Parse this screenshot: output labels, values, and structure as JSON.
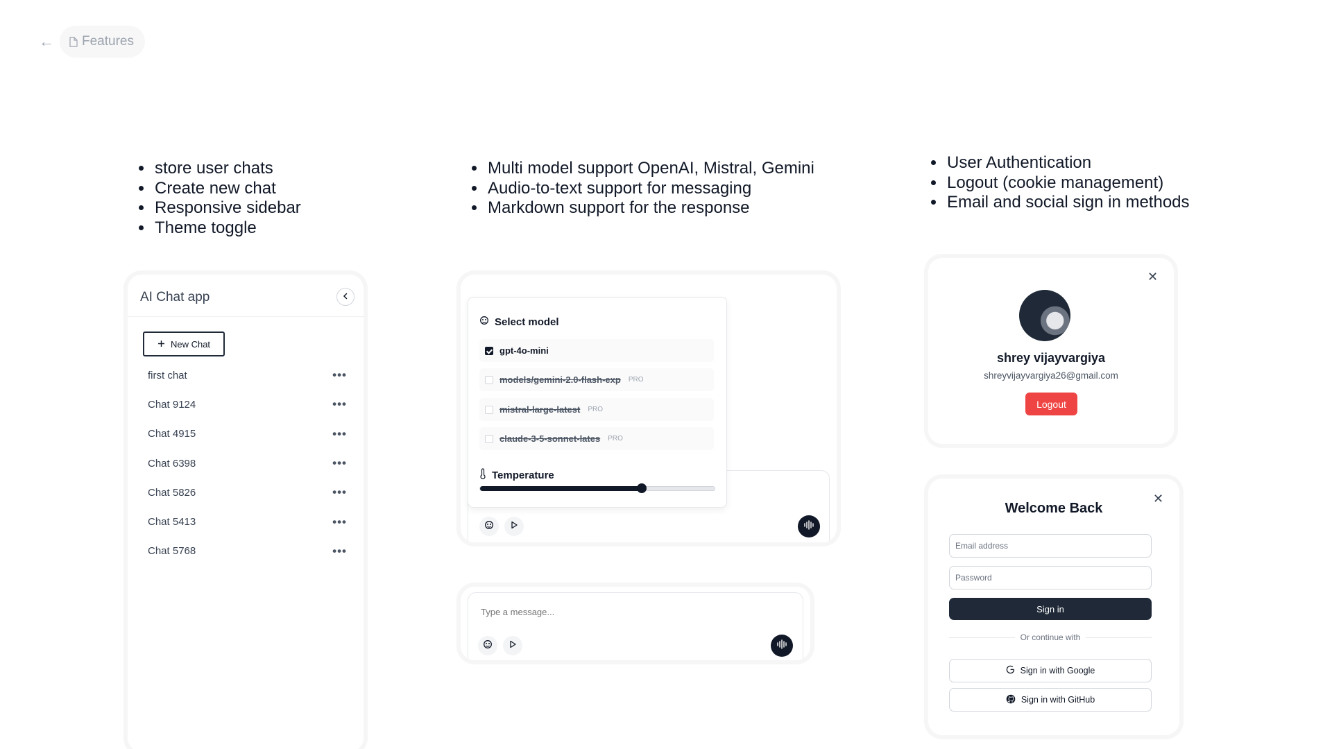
{
  "nav": {
    "back_icon": "arrow-left-icon",
    "crumb_icon": "file-icon",
    "crumb_label": "Features"
  },
  "features_col1": [
    "store user chats",
    "Create new chat",
    "Responsive sidebar",
    "Theme toggle"
  ],
  "features_col2": [
    "Multi model support OpenAI, Mistral, Gemini",
    "Audio-to-text support for messaging",
    "Markdown support for the response"
  ],
  "features_col3": [
    "User Authentication",
    "Logout (cookie management)",
    "Email and social sign in methods"
  ],
  "sidebar": {
    "title": "AI Chat app",
    "new_chat_label": "New Chat",
    "chats": [
      "first chat",
      "Chat 9124",
      "Chat 4915",
      "Chat 6398",
      "Chat 5826",
      "Chat 5413",
      "Chat 5768"
    ],
    "more_label": "•••"
  },
  "model_picker": {
    "title": "Select model",
    "options": [
      {
        "label": "gpt-4o-mini",
        "checked": true,
        "pro": ""
      },
      {
        "label": "models/gemini-2.0-flash-exp",
        "checked": false,
        "pro": "PRO"
      },
      {
        "label": "mistral-large-latest",
        "checked": false,
        "pro": "PRO"
      },
      {
        "label": "claude-3-5-sonnet-lates",
        "checked": false,
        "pro": "PRO"
      }
    ],
    "temperature_label": "Temperature",
    "temperature_value": 0.69
  },
  "composer": {
    "placeholder": "Type a message..."
  },
  "profile": {
    "name": "shrey vijayvargiya",
    "email": "shreyvijayvargiya26@gmail.com",
    "logout_label": "Logout"
  },
  "login": {
    "title": "Welcome Back",
    "email_placeholder": "Email address",
    "password_placeholder": "Password",
    "signin_label": "Sign in",
    "divider_text": "Or continue with",
    "google_label": "Sign in with Google",
    "github_label": "Sign in with GitHub"
  },
  "colors": {
    "logout": "#ef4444",
    "dark": "#1f2937"
  }
}
